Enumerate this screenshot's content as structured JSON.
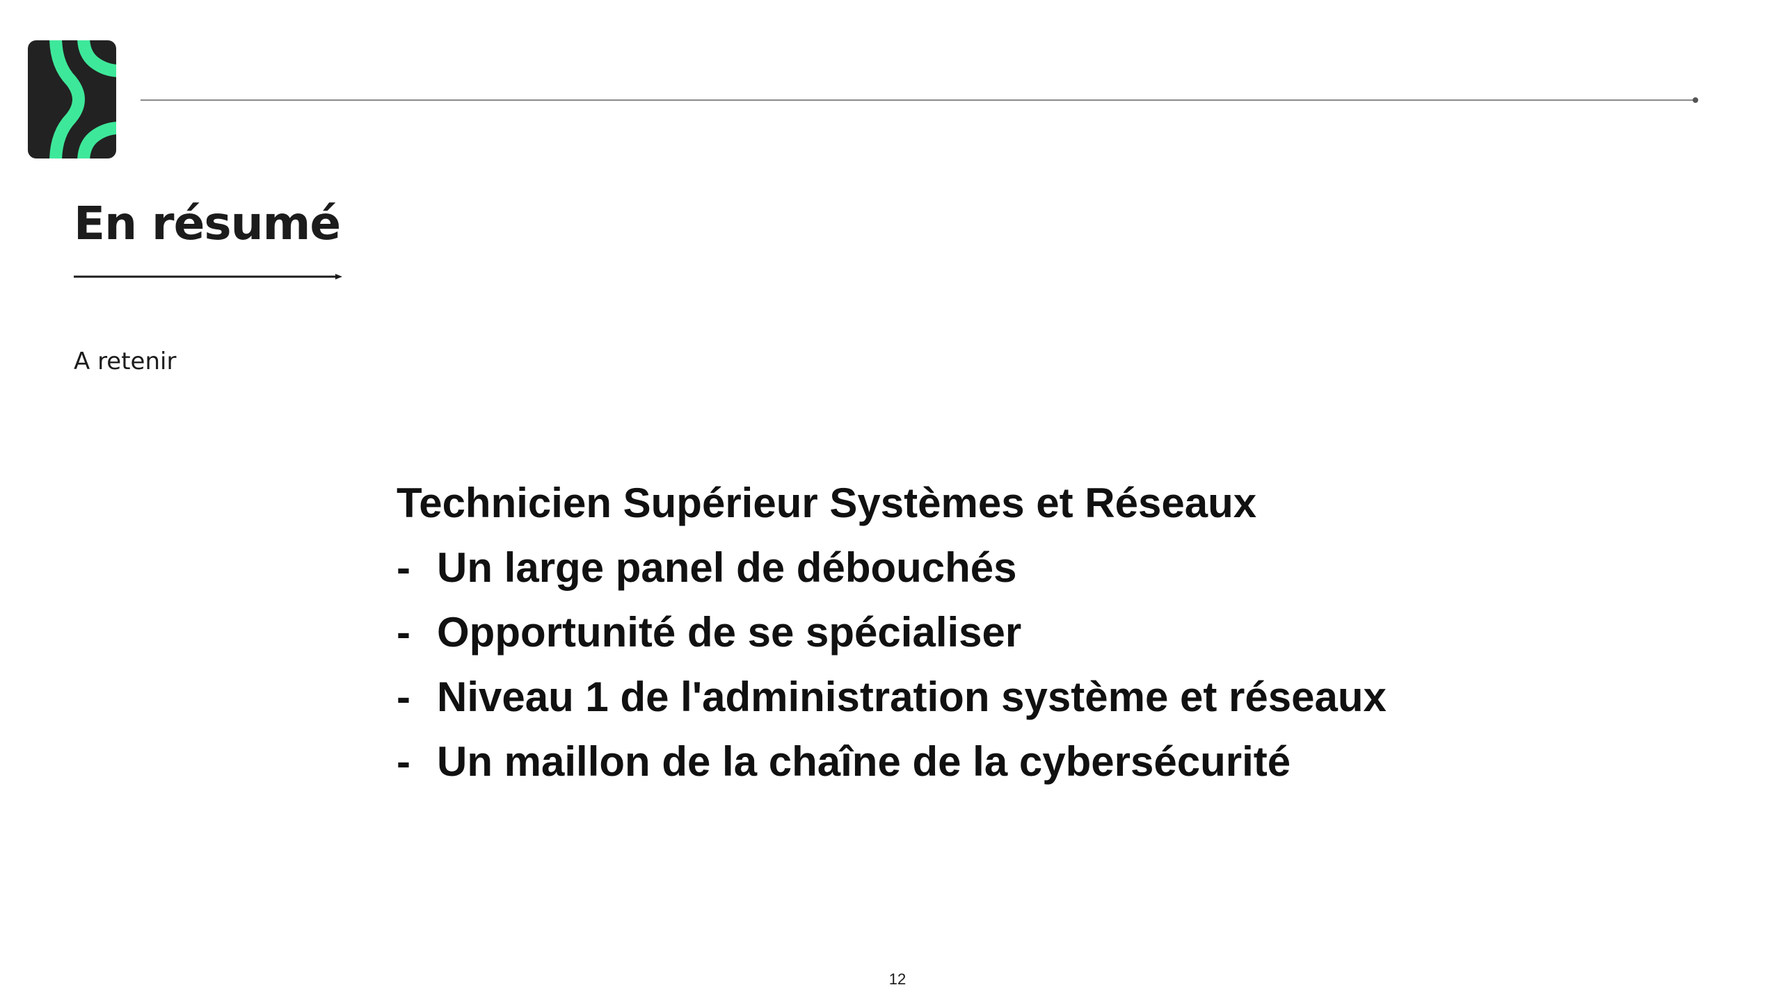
{
  "slide": {
    "title": "En résumé",
    "subtitle": "A retenir",
    "content": {
      "heading": "Technicien Supérieur Systèmes et Réseaux",
      "bullet_marker": "-",
      "bullets": [
        "Un large panel de débouchés",
        "Opportunité de se spécialiser",
        "Niveau 1 de l'administration système et réseaux",
        "Un maillon de la chaîne de la cybersécurité"
      ]
    },
    "page_number": "12"
  },
  "colors": {
    "logo_background": "#222222",
    "logo_accent": "#3ee89a",
    "rule": "#8a8a8a",
    "text": "#111111"
  },
  "icons": {
    "logo": "brand-logo-chevron",
    "top_rule_end": "dot",
    "title_underline_end": "arrow-head"
  }
}
